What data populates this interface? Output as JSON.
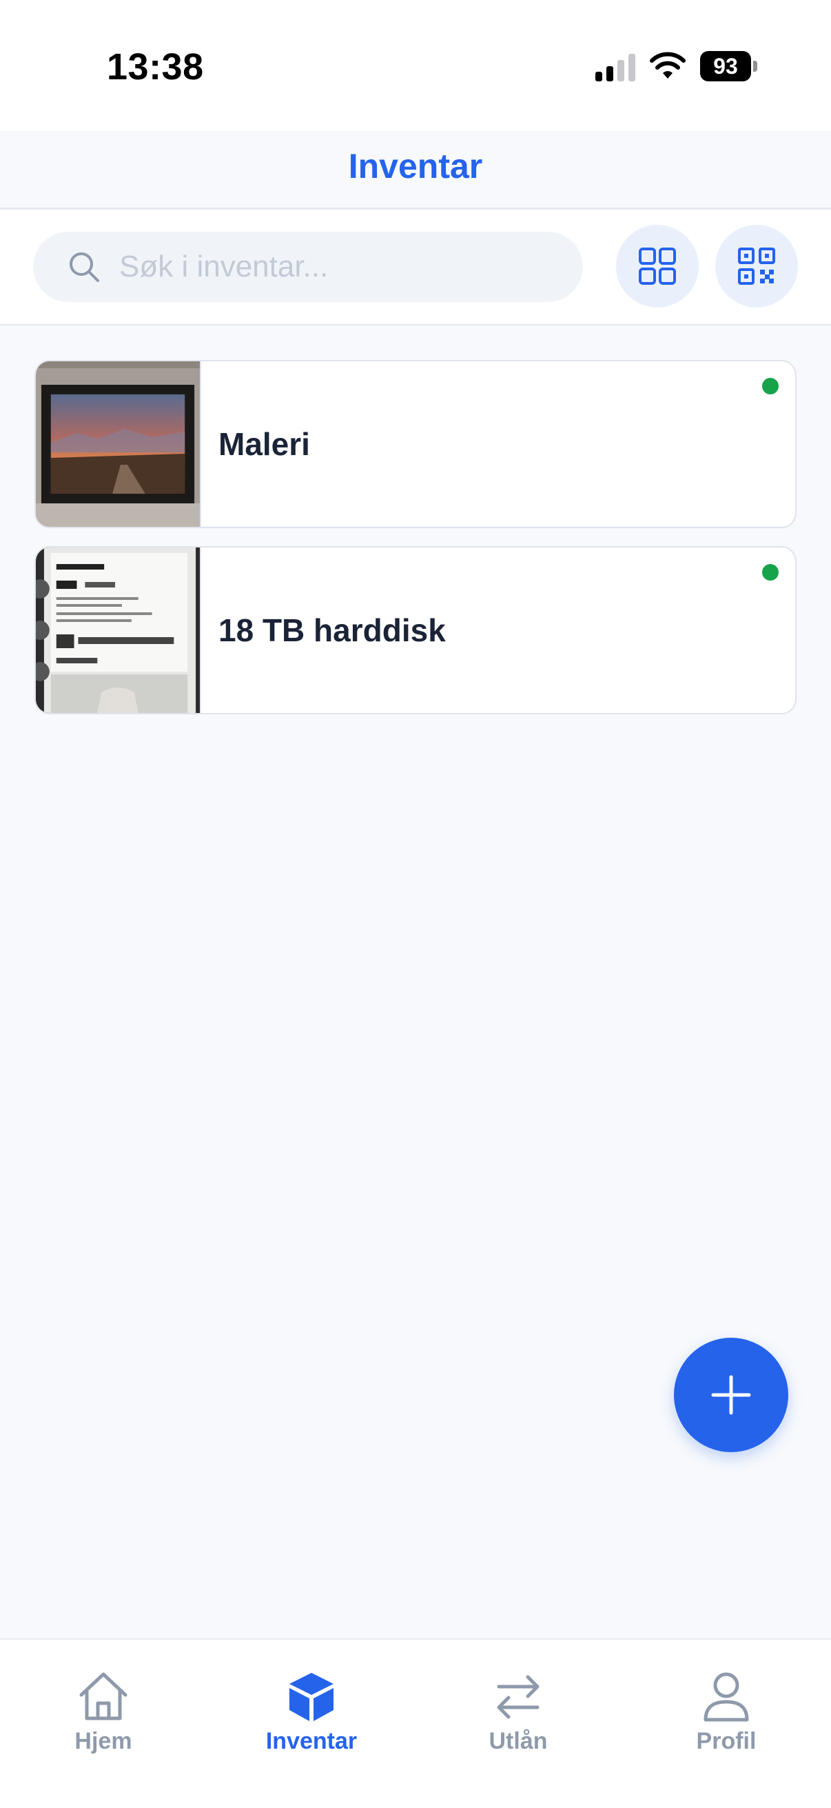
{
  "status_bar": {
    "time": "13:38",
    "battery": "93"
  },
  "header": {
    "title": "Inventar"
  },
  "search": {
    "placeholder": "Søk i inventar..."
  },
  "items": [
    {
      "title": "Maleri",
      "status_color": "#16a34a"
    },
    {
      "title": "18 TB harddisk",
      "status_color": "#16a34a"
    }
  ],
  "tabs": [
    {
      "label": "Hjem",
      "icon": "home-icon"
    },
    {
      "label": "Inventar",
      "icon": "box-icon",
      "active": true
    },
    {
      "label": "Utlån",
      "icon": "swap-icon"
    },
    {
      "label": "Profil",
      "icon": "user-icon"
    }
  ],
  "colors": {
    "accent": "#2563eb",
    "status_ok": "#16a34a",
    "inactive": "#8e9aab"
  }
}
